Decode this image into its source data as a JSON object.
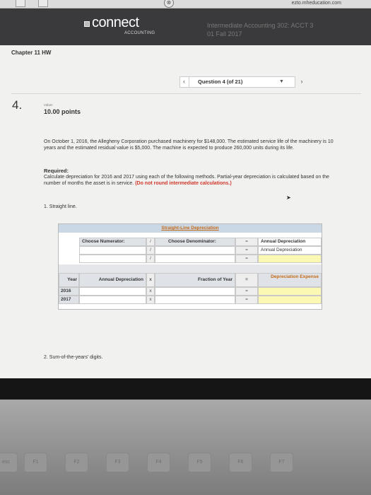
{
  "browser": {
    "url": "ezto.mheducation.com",
    "refresh_icon": "refresh-icon"
  },
  "brand": {
    "logo": "connect",
    "sub": "ACCOUNTING",
    "course": "Intermediate Accounting 302: ACCT 3",
    "term": "01 Fall 2017"
  },
  "chapter": "Chapter 11 HW",
  "nav": {
    "prev": "‹",
    "label": "Question 4 (of 21)",
    "dropdown": "▼",
    "next": "›"
  },
  "question": {
    "number": "4.",
    "value_label": "value:",
    "points": "10.00 points",
    "text": "On October 1, 2016, the Allegheny Corporation purchased machinery for $148,000. The estimated service life of the machinery is 10 years and the estimated residual value is $5,000. The machine is expected to produce 260,000 units during its life.",
    "required_heading": "Required:",
    "required_text": "Calculate depreciation for 2016 and 2017 using each of the following methods. Partial-year depreciation is calculated based on the number of months the asset is in service.",
    "required_note": "(Do not round intermediate calculations.)",
    "part1": "1. Straight line.",
    "part2": "2. Sum-of-the-years' digits."
  },
  "table": {
    "title": "Straight-Line Depreciation",
    "numerator_header": "Choose Numerator:",
    "slash": "/",
    "denominator_header": "Choose Denominator:",
    "equals": "=",
    "annual_dep_header": "Annual Depreciation",
    "annual_dep_value": "Annual Depreciation",
    "year_header": "Year",
    "annual_dep_col": "Annual Depreciation",
    "times": "x",
    "fraction_header": "Fraction of Year",
    "dep_expense_header": "Depreciation Expense",
    "years": [
      "2016",
      "2017"
    ]
  },
  "keyboard": {
    "esc": "esc",
    "f1": "F1",
    "f2": "F2",
    "f3": "F3",
    "f4": "F4",
    "f5": "F5",
    "f6": "F6",
    "f7": "F7"
  }
}
